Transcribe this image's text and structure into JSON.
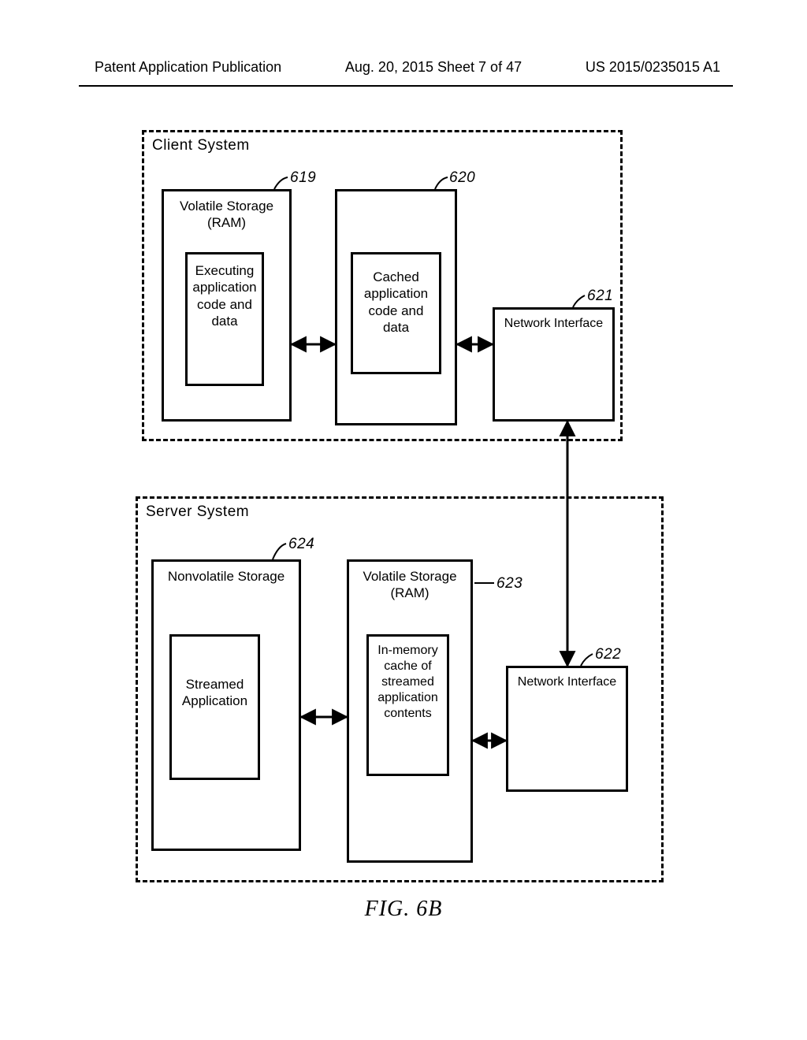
{
  "header": {
    "left": "Patent Application Publication",
    "center": "Aug. 20, 2015  Sheet 7 of 47",
    "right": "US 2015/0235015 A1"
  },
  "client": {
    "title": "Client System",
    "volatile": "Volatile Storage\n(RAM)",
    "exec": "Executing\napplication\ncode and\ndata",
    "cache_box": "",
    "cached": "Cached\napplication\ncode and\ndata",
    "net": "Network Interface"
  },
  "server": {
    "title": "Server System",
    "nonvol": "Nonvolatile Storage",
    "streamed": "Streamed\nApplication",
    "volatile": "Volatile Storage\n(RAM)",
    "inmem": "In-memory\ncache of\nstreamed\napplication\ncontents",
    "net": "Network Interface"
  },
  "refs": {
    "r619": "619",
    "r620": "620",
    "r621": "621",
    "r622": "622",
    "r623": "623",
    "r624": "624"
  },
  "figure": "FIG. 6B"
}
